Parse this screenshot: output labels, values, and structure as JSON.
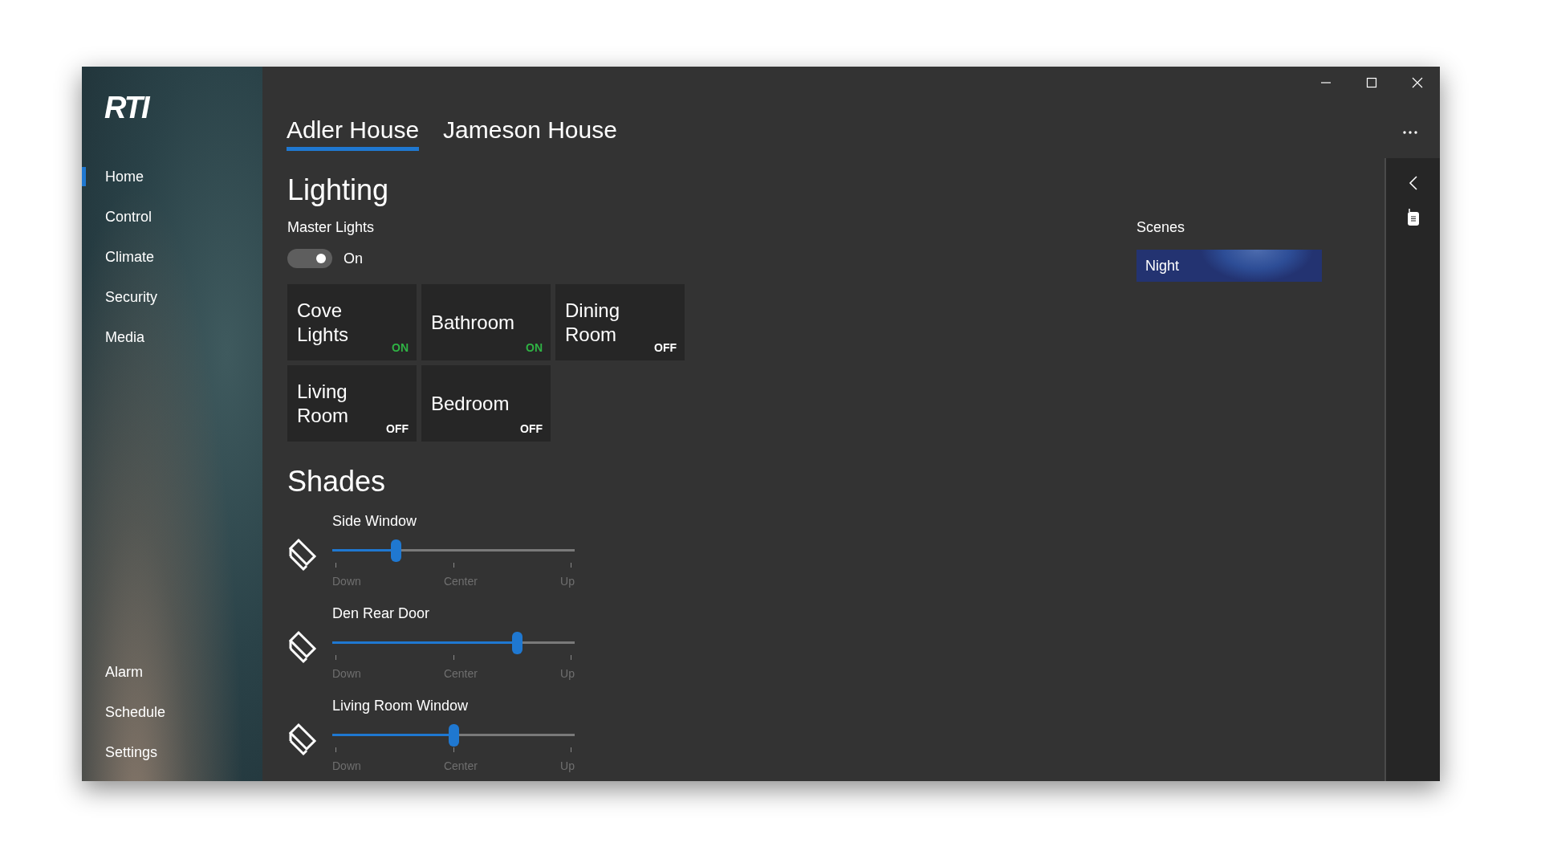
{
  "logo": "RTI",
  "nav": {
    "top": [
      {
        "label": "Home",
        "selected": true
      },
      {
        "label": "Control",
        "selected": false
      },
      {
        "label": "Climate",
        "selected": false
      },
      {
        "label": "Security",
        "selected": false
      },
      {
        "label": "Media",
        "selected": false
      }
    ],
    "bottom": [
      {
        "label": "Alarm",
        "selected": false
      },
      {
        "label": "Schedule",
        "selected": false
      },
      {
        "label": "Settings",
        "selected": false
      }
    ]
  },
  "tabs": [
    {
      "label": "Adler House",
      "selected": true
    },
    {
      "label": "Jameson House",
      "selected": false
    }
  ],
  "lighting": {
    "title": "Lighting",
    "master": {
      "label": "Master Lights",
      "on": true,
      "state_text": "On"
    },
    "tiles": [
      {
        "name": "Cove Lights",
        "status": "ON",
        "on": true
      },
      {
        "name": "Bathroom",
        "status": "ON",
        "on": true
      },
      {
        "name": "Dining Room",
        "status": "OFF",
        "on": false
      },
      {
        "name": "Living Room",
        "status": "OFF",
        "on": false
      },
      {
        "name": "Bedroom",
        "status": "OFF",
        "on": false
      }
    ]
  },
  "scenes": {
    "title": "Scenes",
    "items": [
      {
        "label": "Night"
      }
    ]
  },
  "shades": {
    "title": "Shades",
    "items": [
      {
        "name": "Side Window",
        "level": 0.26,
        "ticks": [
          "Down",
          "Center",
          "Up"
        ]
      },
      {
        "name": "Den Rear Door",
        "level": 0.76,
        "ticks": [
          "Down",
          "Center",
          "Up"
        ]
      },
      {
        "name": "Living Room Window",
        "level": 0.5,
        "ticks": [
          "Down",
          "Center",
          "Up"
        ]
      }
    ]
  }
}
